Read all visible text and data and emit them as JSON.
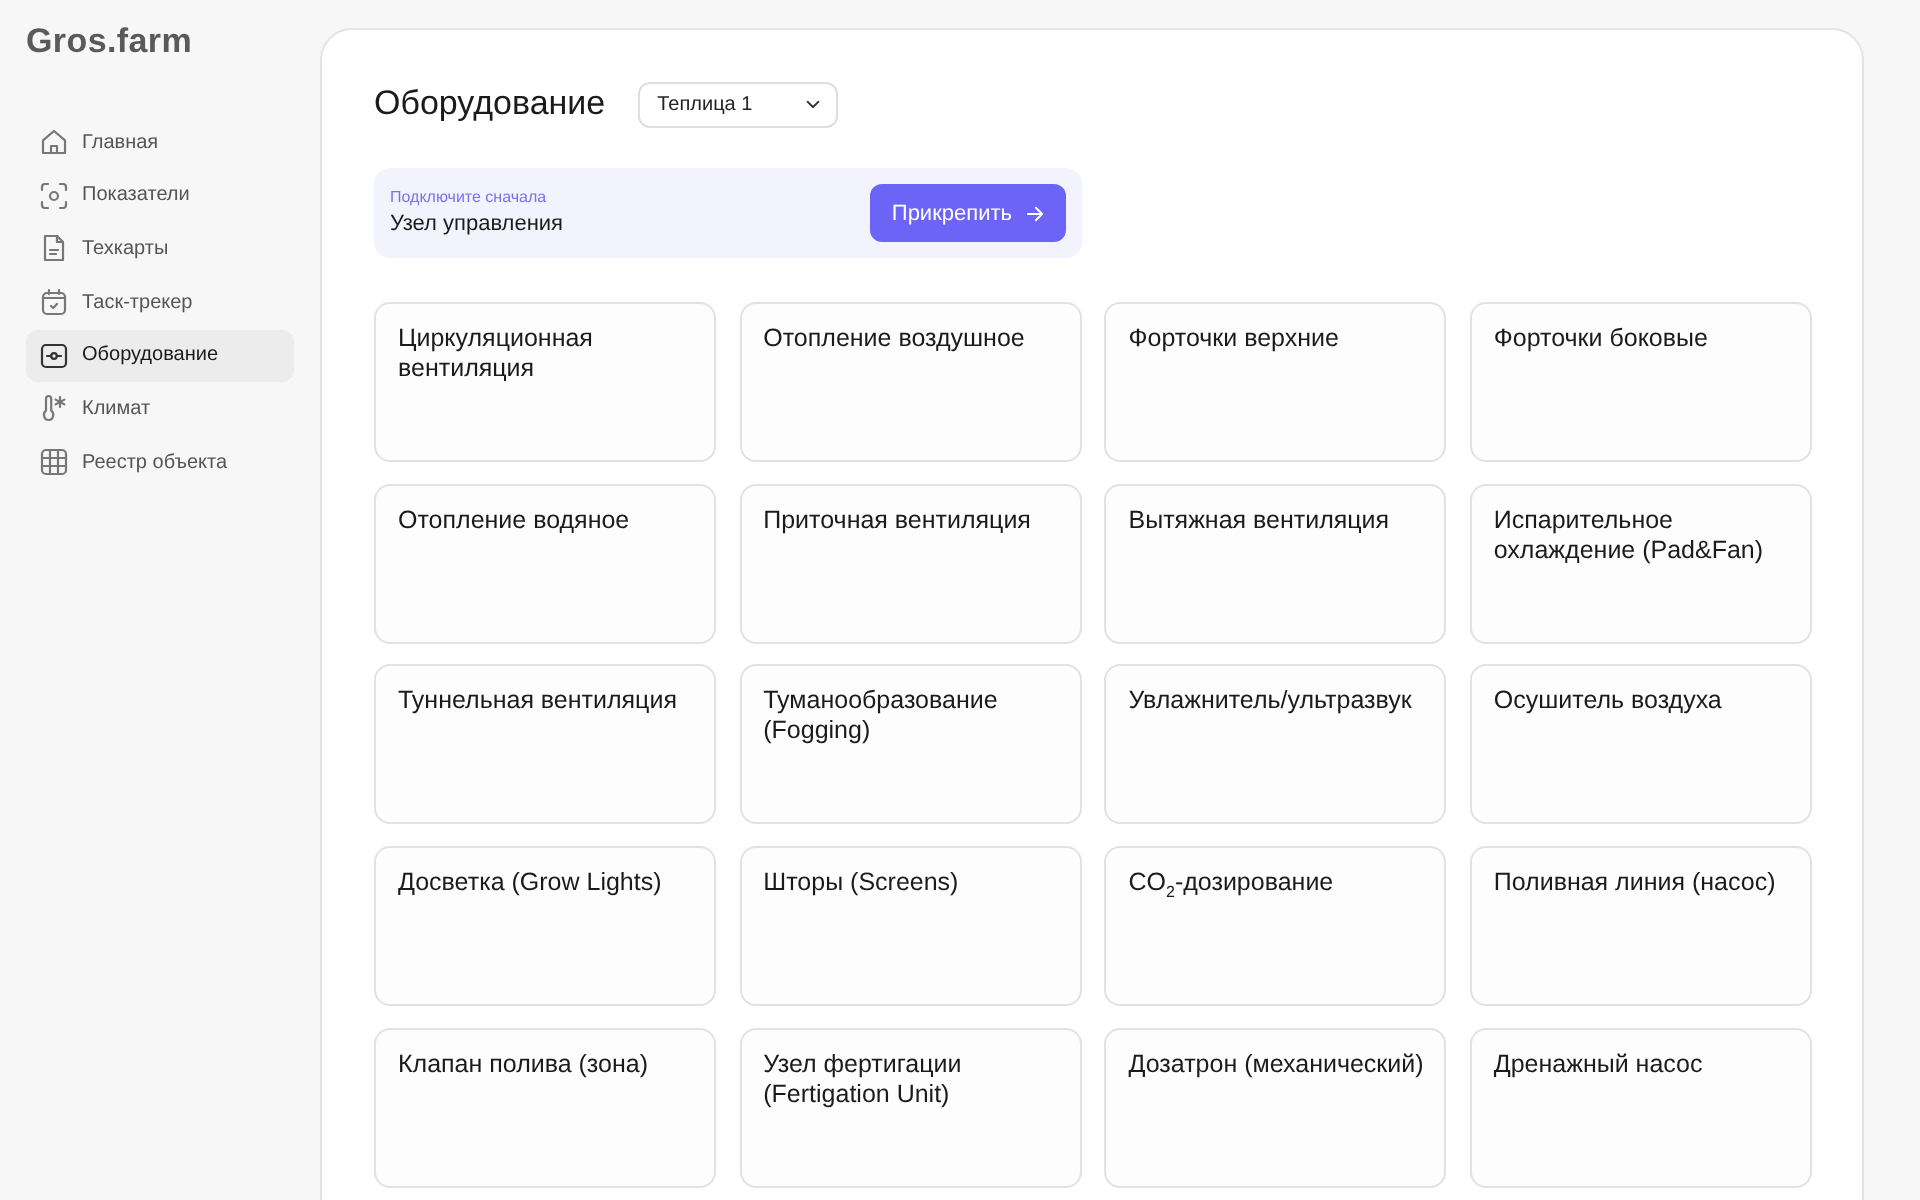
{
  "brand": {
    "logo": "Gros.farm"
  },
  "sidebar": {
    "items": [
      {
        "label": "Главная",
        "selected": false
      },
      {
        "label": "Показатели",
        "selected": false
      },
      {
        "label": "Техкарты",
        "selected": false
      },
      {
        "label": "Таск-трекер",
        "selected": false
      },
      {
        "label": "Оборудование",
        "selected": true
      },
      {
        "label": "Климат",
        "selected": false
      },
      {
        "label": "Реестр объекта",
        "selected": false
      }
    ]
  },
  "header": {
    "title": "Оборудование",
    "greenhouse_select": {
      "value": "Теплица 1"
    }
  },
  "notice": {
    "hint": "Подключите сначала",
    "text": "Узел управления",
    "button": "Прикрепить"
  },
  "equipment": [
    {
      "label": "Циркуляционная вентиляция"
    },
    {
      "label": "Отопление воздушное"
    },
    {
      "label": "Форточки верхние"
    },
    {
      "label": "Форточки боковые"
    },
    {
      "label": "Отопление водяное"
    },
    {
      "label": "Приточная вентиляция"
    },
    {
      "label": "Вытяжная вентиляция"
    },
    {
      "label": "Испарительное охлаждение (Pad&Fan)"
    },
    {
      "label": "Туннельная вентиляция"
    },
    {
      "label": "Туманообразование (Fogging)"
    },
    {
      "label": "Увлажнитель/ультразвук"
    },
    {
      "label": "Осушитель воздуха"
    },
    {
      "label": "Досветка (Grow Lights)"
    },
    {
      "label": "Шторы (Screens)"
    },
    {
      "label": "CO$_{2}$-дозирование"
    },
    {
      "label": "Поливная линия (насос)"
    },
    {
      "label": "Клапан полива (зона)"
    },
    {
      "label": "Узел фертигации (Fertigation Unit)"
    },
    {
      "label": "Дозатрон (механический)"
    },
    {
      "label": "Дренажный насос"
    }
  ]
}
